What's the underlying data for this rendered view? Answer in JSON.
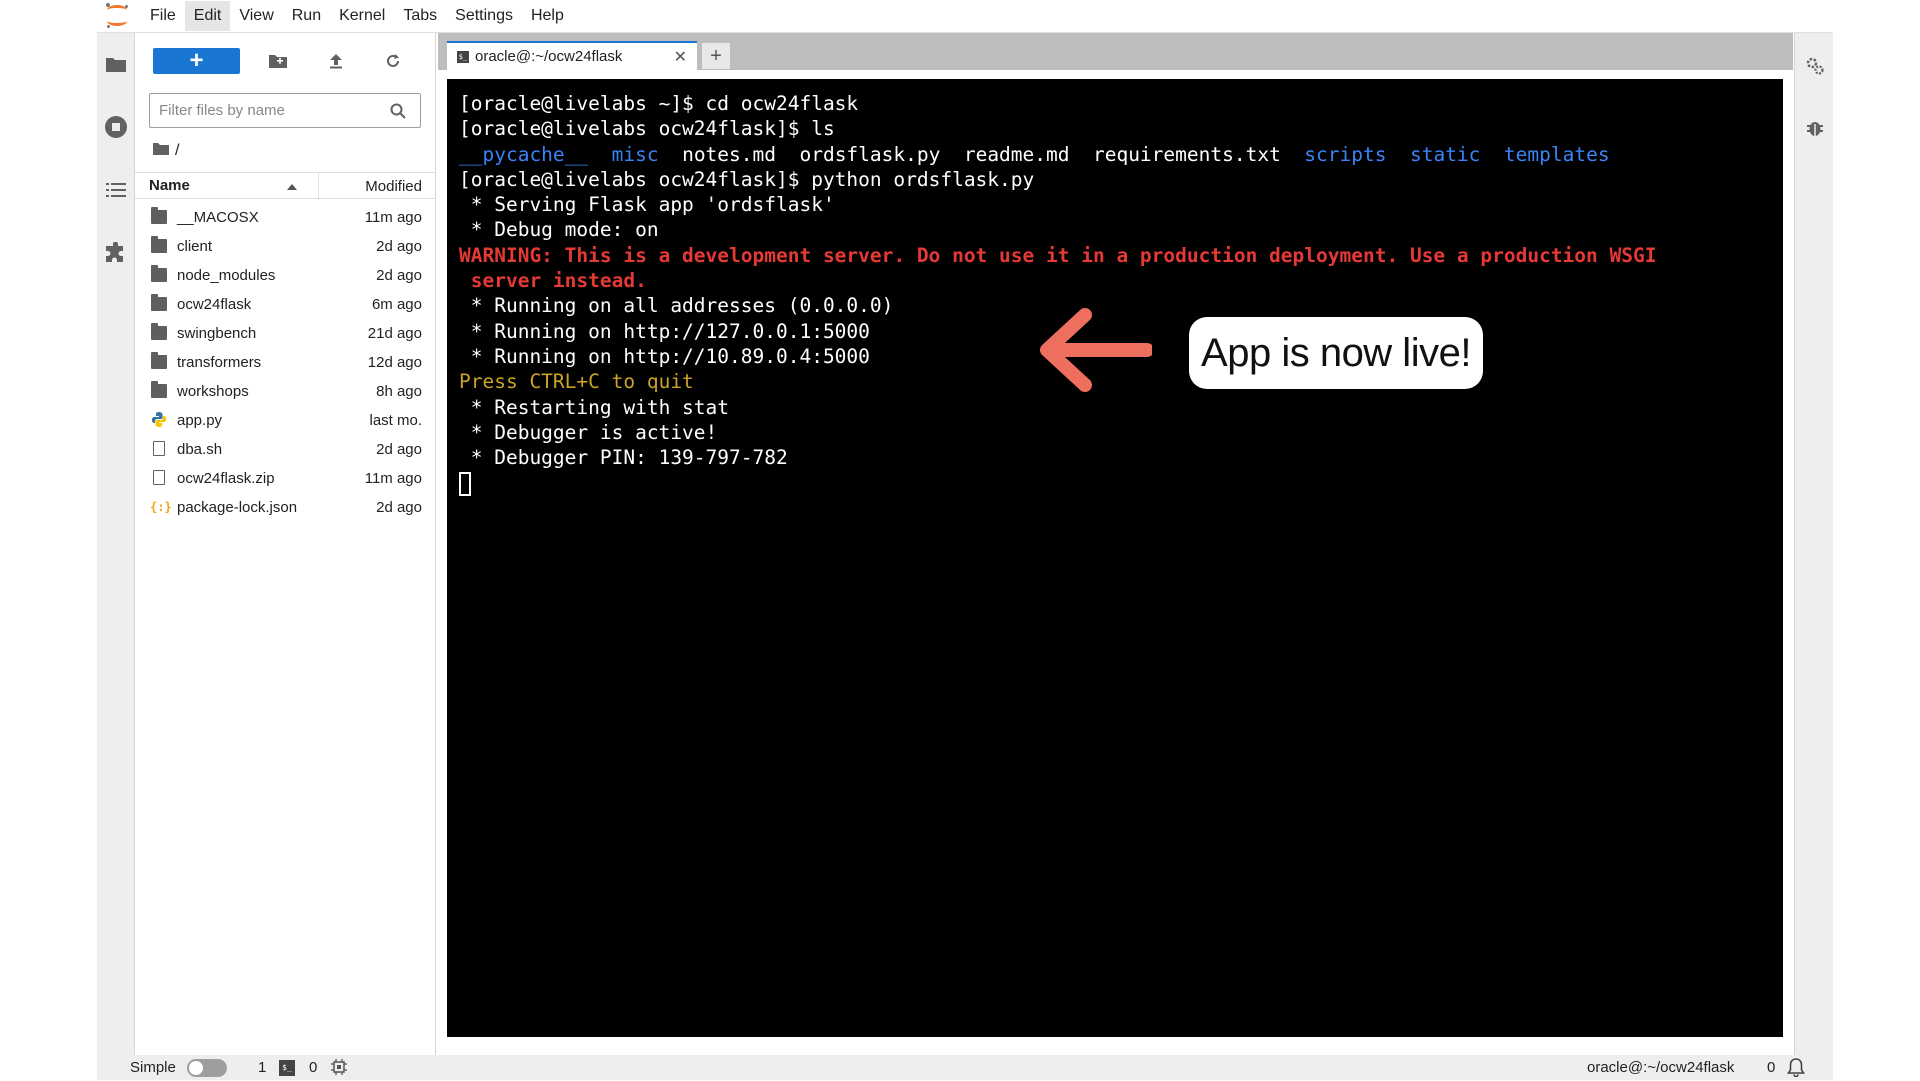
{
  "menubar": {
    "items": [
      "File",
      "Edit",
      "View",
      "Run",
      "Kernel",
      "Tabs",
      "Settings",
      "Help"
    ],
    "active": "Edit"
  },
  "file_browser": {
    "new_button_label": "+",
    "filter_placeholder": "Filter files by name",
    "path": "/",
    "columns": {
      "name": "Name",
      "modified": "Modified"
    },
    "files": [
      {
        "name": "__MACOSX",
        "modified": "11m ago",
        "kind": "folder"
      },
      {
        "name": "client",
        "modified": "2d ago",
        "kind": "folder"
      },
      {
        "name": "node_modules",
        "modified": "2d ago",
        "kind": "folder"
      },
      {
        "name": "ocw24flask",
        "modified": "6m ago",
        "kind": "folder"
      },
      {
        "name": "swingbench",
        "modified": "21d ago",
        "kind": "folder"
      },
      {
        "name": "transformers",
        "modified": "12d ago",
        "kind": "folder"
      },
      {
        "name": "workshops",
        "modified": "8h ago",
        "kind": "folder"
      },
      {
        "name": "app.py",
        "modified": "last mo.",
        "kind": "python"
      },
      {
        "name": "dba.sh",
        "modified": "2d ago",
        "kind": "file"
      },
      {
        "name": "ocw24flask.zip",
        "modified": "11m ago",
        "kind": "file"
      },
      {
        "name": "package-lock.json",
        "modified": "2d ago",
        "kind": "json"
      }
    ]
  },
  "tab": {
    "label": "oracle@:~/ocw24flask",
    "add_label": "+"
  },
  "terminal": {
    "lines": [
      {
        "text": "[oracle@livelabs ~]$ cd ocw24flask",
        "style": "plain"
      },
      {
        "text": "[oracle@livelabs ocw24flask]$ ls",
        "style": "plain"
      },
      {
        "segments": [
          {
            "text": "__pycache__",
            "style": "blue"
          },
          {
            "text": "  ",
            "style": "plain"
          },
          {
            "text": "misc",
            "style": "blue"
          },
          {
            "text": "  notes.md  ordsflask.py  readme.md  requirements.txt  ",
            "style": "plain"
          },
          {
            "text": "scripts",
            "style": "blue"
          },
          {
            "text": "  ",
            "style": "plain"
          },
          {
            "text": "static",
            "style": "blue"
          },
          {
            "text": "  ",
            "style": "plain"
          },
          {
            "text": "templates",
            "style": "blue"
          }
        ]
      },
      {
        "text": "[oracle@livelabs ocw24flask]$ python ordsflask.py",
        "style": "plain"
      },
      {
        "text": " * Serving Flask app 'ordsflask'",
        "style": "plain"
      },
      {
        "text": " * Debug mode: on",
        "style": "plain"
      },
      {
        "text": "WARNING: This is a development server. Do not use it in a production deployment. Use a production WSGI",
        "style": "red"
      },
      {
        "text": " server instead.",
        "style": "red"
      },
      {
        "text": " * Running on all addresses (0.0.0.0)",
        "style": "plain"
      },
      {
        "text": " * Running on http://127.0.0.1:5000",
        "style": "plain"
      },
      {
        "text": " * Running on http://10.89.0.4:5000",
        "style": "plain"
      },
      {
        "text": "Press CTRL+C to quit",
        "style": "yellow"
      },
      {
        "text": " * Restarting with stat",
        "style": "plain"
      },
      {
        "text": " * Debugger is active!",
        "style": "plain"
      },
      {
        "text": " * Debugger PIN: 139-797-782",
        "style": "plain"
      }
    ]
  },
  "annotation": {
    "callout_text": "App is now live!",
    "arrow_color": "#ef6f5e"
  },
  "statusbar": {
    "simple_label": "Simple",
    "terminals_count": "1",
    "kernels_count": "0",
    "current_path": "oracle@:~/ocw24flask",
    "notifications_count": "0"
  },
  "colors": {
    "accent": "#1976d2",
    "terminal_bg": "#000000",
    "terminal_blue": "#3b82f6",
    "terminal_red": "#e53935",
    "terminal_yellow": "#c9a227"
  }
}
